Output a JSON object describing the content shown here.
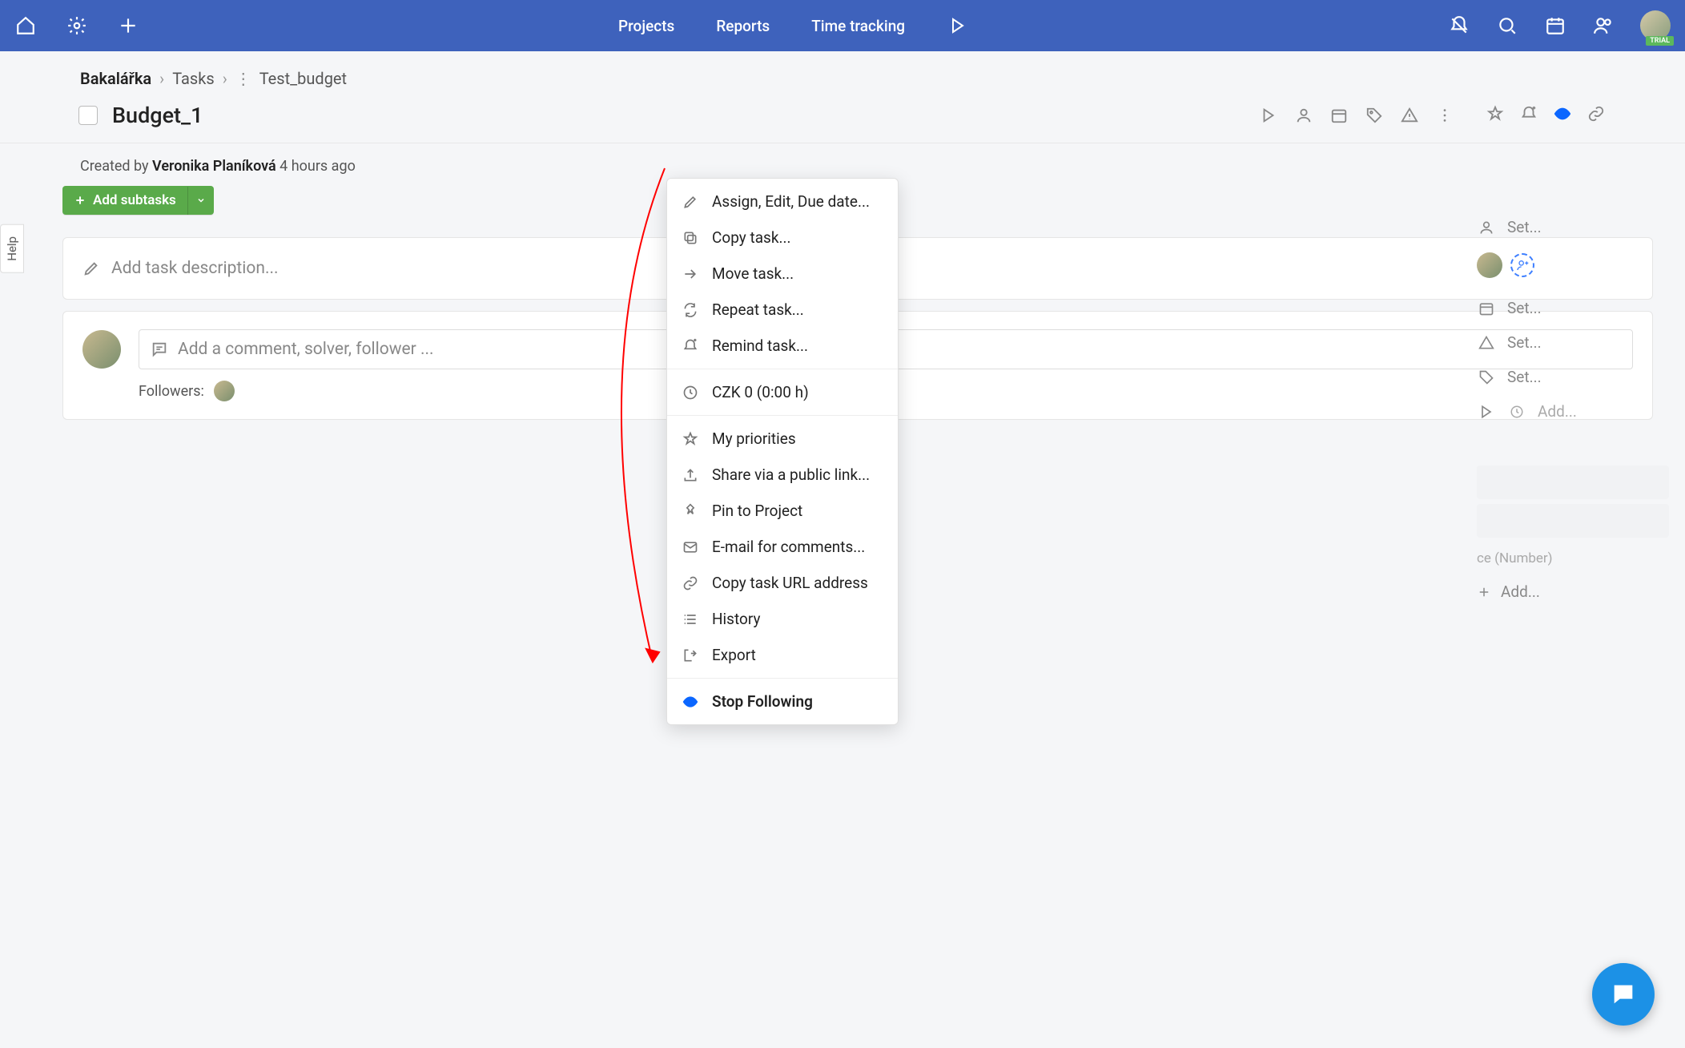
{
  "topbar": {
    "nav": {
      "projects": "Projects",
      "reports": "Reports",
      "time_tracking": "Time tracking"
    },
    "trial": "TRIAL"
  },
  "help_tab": "Help",
  "breadcrumb": {
    "project": "Bakalářka",
    "section": "Tasks",
    "item": "Test_budget"
  },
  "task": {
    "title": "Budget_1",
    "created_by_prefix": "Created by ",
    "author": "Veronika Planíková",
    "time_ago": " 4 hours ago"
  },
  "subtasks_btn": "Add subtasks",
  "description_placeholder": "Add task description...",
  "comment_placeholder": "Add a comment, solver, follower ...",
  "followers_label": "Followers:",
  "sidebar": {
    "set": "Set...",
    "add": "Add...",
    "ce_hint": "ce  (Number)"
  },
  "menu": {
    "assign": "Assign, Edit, Due date...",
    "copy": "Copy task...",
    "move": "Move task...",
    "repeat": "Repeat task...",
    "remind": "Remind task...",
    "budget": "CZK 0 (0:00 h)",
    "priorities": "My priorities",
    "share": "Share via a public link...",
    "pin": "Pin to Project",
    "email": "E-mail for comments...",
    "copy_url": "Copy task URL address",
    "history": "History",
    "export": "Export",
    "stop_follow": "Stop Following"
  }
}
